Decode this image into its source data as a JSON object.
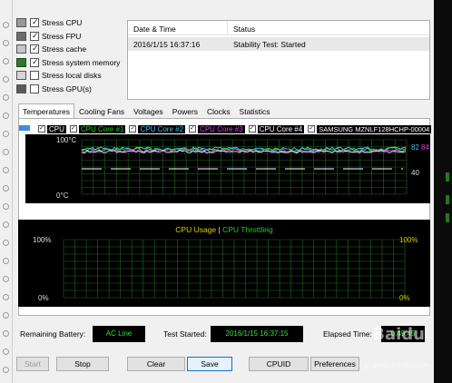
{
  "stress_options": [
    {
      "label": "Stress CPU",
      "checked": true,
      "icon": "cpu-icon"
    },
    {
      "label": "Stress FPU",
      "checked": true,
      "icon": "fpu-icon"
    },
    {
      "label": "Stress cache",
      "checked": true,
      "icon": "cache-icon"
    },
    {
      "label": "Stress system memory",
      "checked": true,
      "icon": "memory-icon"
    },
    {
      "label": "Stress local disks",
      "checked": false,
      "icon": "disk-icon"
    },
    {
      "label": "Stress GPU(s)",
      "checked": false,
      "icon": "gpu-icon"
    }
  ],
  "log": {
    "col_date": "Date & Time",
    "col_status": "Status",
    "rows": [
      {
        "date": "2016/1/15 16:37:16",
        "status": "Stability Test: Started"
      }
    ]
  },
  "tabs": [
    "Temperatures",
    "Cooling Fans",
    "Voltages",
    "Powers",
    "Clocks",
    "Statistics"
  ],
  "active_tab": "Temperatures",
  "temp_graph": {
    "legend": [
      {
        "label": "CPU",
        "color": "#ffffff",
        "checked": true
      },
      {
        "label": "CPU Core #1",
        "color": "#1ed11e",
        "checked": true
      },
      {
        "label": "CPU Core #2",
        "color": "#3fc3f0",
        "checked": true
      },
      {
        "label": "CPU Core #3",
        "color": "#e040e0",
        "checked": true
      },
      {
        "label": "CPU Core #4",
        "color": "#ffffff",
        "checked": true
      },
      {
        "label": "SAMSUNG MZNLF128HCHP-00004",
        "color": "#ffffff",
        "checked": true
      }
    ],
    "y_top_label": "100°C",
    "y_bottom_label": "0°C",
    "right_value_1": "82",
    "right_value_2": "84",
    "right_value_3": "40"
  },
  "usage_graph": {
    "title_usage": "CPU Usage",
    "separator": "|",
    "title_throttling": "CPU Throttling",
    "left_top": "100%",
    "left_bottom": "0%",
    "right_top": "100%",
    "right_bottom": "0%"
  },
  "status": {
    "battery_label": "Remaining Battery:",
    "battery_value": "AC Line",
    "started_label": "Test Started:",
    "started_value": "2016/1/15 16:37:15",
    "elapsed_label": "Elapsed Time:",
    "elapsed_value": "0:49:45"
  },
  "buttons": {
    "start": "Start",
    "stop": "Stop",
    "clear": "Clear",
    "save": "Save",
    "cpuid": "CPUID",
    "preferences": "Preferences"
  },
  "watermark": {
    "brand": "Baidu",
    "sub": "jingyan.baidu.com"
  },
  "colors": {
    "graph_bg": "#000000",
    "grid": "#1f6a1f",
    "status_green": "#39e039",
    "usage_yellow": "#d8d000"
  }
}
